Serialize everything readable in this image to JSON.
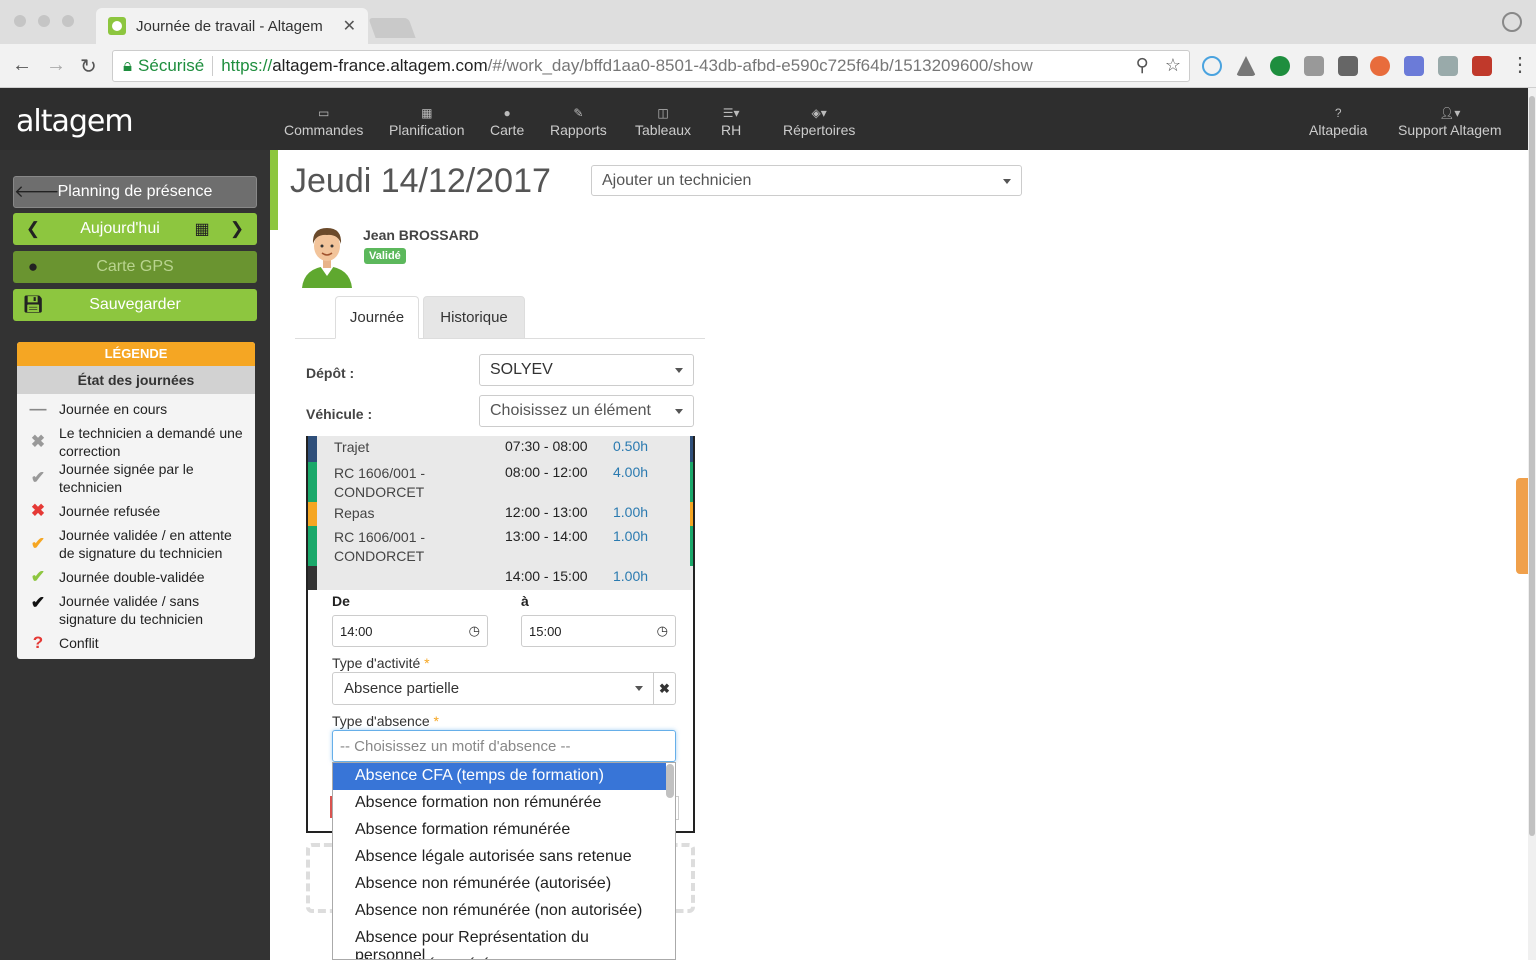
{
  "browser": {
    "tab_title": "Journée de travail - Altagem",
    "secure_label": "Sécurisé",
    "url_scheme": "https://",
    "url_host": "altagem-france.altagem.com",
    "url_path": "/#/work_day/bffd1aa0-8501-43db-afbd-e590c725f64b/1513209600/show"
  },
  "app": {
    "logo_text_a": "al",
    "logo_text_b": "tagem",
    "menu": [
      {
        "label": "Commandes",
        "icon": "inbox-icon"
      },
      {
        "label": "Planification",
        "icon": "calendar-icon"
      },
      {
        "label": "Carte",
        "icon": "map-pin-icon"
      },
      {
        "label": "Rapports",
        "icon": "edit-icon"
      },
      {
        "label": "Tableaux",
        "icon": "columns-icon"
      },
      {
        "label": "RH",
        "icon": "list-icon"
      },
      {
        "label": "Répertoires",
        "icon": "cube-icon"
      }
    ],
    "right_menu": [
      {
        "label": "Altapedia",
        "icon": "question-icon"
      },
      {
        "label": "Support Altagem",
        "icon": "user-icon"
      }
    ]
  },
  "sidebar": {
    "back_label": "Planning de présence",
    "today_label": "Aujourd'hui",
    "gps_label": "Carte GPS",
    "save_label": "Sauvegarder",
    "legend_title": "LÉGENDE",
    "legend_subtitle": "État des journées",
    "legend_items": [
      {
        "icon": "—",
        "color": "#888888",
        "text": "Journée en cours"
      },
      {
        "icon": "✖",
        "color": "#999999",
        "text": "Le technicien a demandé une correction"
      },
      {
        "icon": "✔",
        "color": "#999999",
        "text": "Journée signée par le technicien"
      },
      {
        "icon": "✖",
        "color": "#e53935",
        "text": "Journée refusée"
      },
      {
        "icon": "✔",
        "color": "#f5a623",
        "text": "Journée validée / en attente de signature du technicien"
      },
      {
        "icon": "✔",
        "color": "#8dc63f",
        "text": "Journée double-validée"
      },
      {
        "icon": "✔",
        "color": "#111111",
        "text": "Journée validée / sans signature du technicien"
      },
      {
        "icon": "?",
        "color": "#e53935",
        "text": "Conflit"
      }
    ]
  },
  "main": {
    "title": "Jeudi 14/12/2017",
    "add_tech_placeholder": "Ajouter un technicien",
    "tech_name": "Jean BROSSARD",
    "tech_status": "Validé",
    "tabs": [
      "Journée",
      "Historique"
    ],
    "depot_label": "Dépôt :",
    "depot_value": "SOLYEV",
    "vehicle_label": "Véhicule :",
    "vehicle_value": "Choisissez un élément",
    "timeline": [
      {
        "name": "Trajet",
        "time": "07:30 - 08:00",
        "hours": "0.50h",
        "color": "#2f4f7a"
      },
      {
        "name": "RC 1606/001 - CONDORCET",
        "time": "08:00 - 12:00",
        "hours": "4.00h",
        "color": "#1aa86a"
      },
      {
        "name": "Repas",
        "time": "12:00 - 13:00",
        "hours": "1.00h",
        "color": "#f5a623"
      },
      {
        "name": "RC 1606/001 - CONDORCET",
        "time": "13:00 - 14:00",
        "hours": "1.00h",
        "color": "#1aa86a"
      },
      {
        "name": "",
        "time": "14:00 - 15:00",
        "hours": "1.00h",
        "color": "#333333"
      }
    ],
    "from_label": "De",
    "to_label": "à",
    "from_value": "14:00",
    "to_value": "15:00",
    "activity_label": "Type d'activité",
    "activity_value": "Absence partielle",
    "absence_label": "Type d'absence",
    "absence_placeholder": "-- Choisissez un motif d'absence --",
    "absence_options": [
      "Absence CFA (temps de formation)",
      "Absence formation non rémunérée",
      "Absence formation rémunérée",
      "Absence légale autorisée sans retenue",
      "Absence non rémunérée (autorisée)",
      "Absence non rémunérée (non autorisée)",
      "Absence pour Représentation du personnel",
      "Absence rémunérée"
    ],
    "required_mark": "*"
  }
}
